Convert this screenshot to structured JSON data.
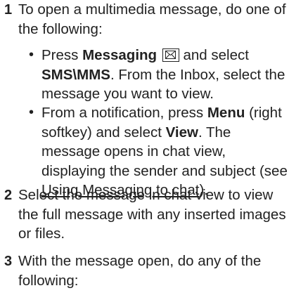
{
  "steps": [
    {
      "number": "1",
      "text": "To open a multimedia message, do one of the following:",
      "bullets": [
        {
          "pre": "Press ",
          "bold1": "Messaging",
          "icon": "messaging-envelope-icon",
          "mid": " and select ",
          "bold2": "SMS\\MMS",
          "post": ". From the Inbox, select the message you want to view."
        },
        {
          "pre": "From a notification, press ",
          "bold1": "Menu",
          "mid": " (right softkey) and select ",
          "bold2": "View",
          "post": ". The message opens in chat view, displaying the sender and subject (see ",
          "link": "Using Messaging to chat",
          "end": ")."
        }
      ]
    },
    {
      "number": "2",
      "text": "Select the message in chat view to view the full message with any inserted images or files."
    },
    {
      "number": "3",
      "text": "With the message open, do any of the following:"
    }
  ]
}
